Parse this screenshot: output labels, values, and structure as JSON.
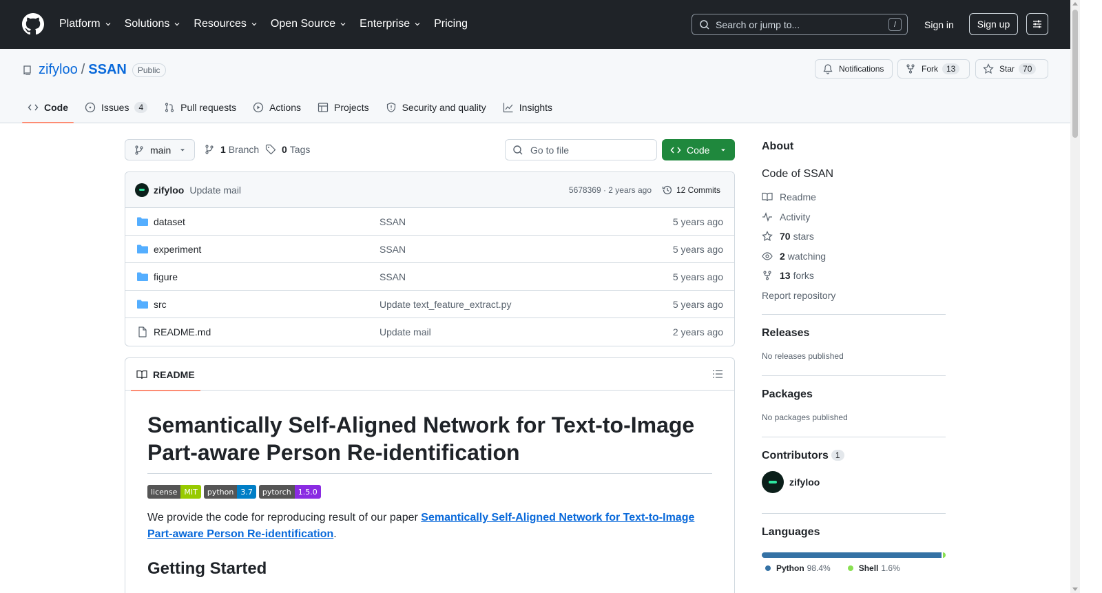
{
  "header": {
    "nav": [
      {
        "label": "Platform"
      },
      {
        "label": "Solutions"
      },
      {
        "label": "Resources"
      },
      {
        "label": "Open Source"
      },
      {
        "label": "Enterprise"
      },
      {
        "label": "Pricing"
      }
    ],
    "search_placeholder": "Search or jump to...",
    "search_shortcut": "/",
    "sign_in": "Sign in",
    "sign_up": "Sign up"
  },
  "repo": {
    "owner": "zifyloo",
    "separator": "/",
    "name": "SSAN",
    "visibility": "Public",
    "notifications_label": "Notifications",
    "fork_label": "Fork",
    "fork_count": "13",
    "star_label": "Star",
    "star_count": "70"
  },
  "tabs": [
    {
      "label": "Code",
      "icon": "code-icon"
    },
    {
      "label": "Issues",
      "icon": "issue-icon",
      "count": "4"
    },
    {
      "label": "Pull requests",
      "icon": "pull-request-icon"
    },
    {
      "label": "Actions",
      "icon": "play-icon"
    },
    {
      "label": "Projects",
      "icon": "table-icon"
    },
    {
      "label": "Security and quality",
      "icon": "shield-icon"
    },
    {
      "label": "Insights",
      "icon": "graph-icon"
    }
  ],
  "branch": {
    "current": "main",
    "branch_count": "1",
    "branch_label": "Branch",
    "tag_count": "0",
    "tag_label": "Tags",
    "goto_placeholder": "Go to file",
    "code_button": "Code"
  },
  "latest_commit": {
    "author": "zifyloo",
    "message": "Update mail",
    "hash_time": "5678369 · 2 years ago",
    "commits_label": "12 Commits"
  },
  "files": [
    {
      "name": "dataset",
      "type": "dir",
      "message": "SSAN",
      "date": "5 years ago"
    },
    {
      "name": "experiment",
      "type": "dir",
      "message": "SSAN",
      "date": "5 years ago"
    },
    {
      "name": "figure",
      "type": "dir",
      "message": "SSAN",
      "date": "5 years ago"
    },
    {
      "name": "src",
      "type": "dir",
      "message": "Update text_feature_extract.py",
      "date": "5 years ago"
    },
    {
      "name": "README.md",
      "type": "file",
      "message": "Update mail",
      "date": "2 years ago"
    }
  ],
  "readme": {
    "tab_label": "README",
    "title": "Semantically Self-Aligned Network for Text-to-Image Part-aware Person Re-identification",
    "badges": [
      {
        "key": "license",
        "value": "MIT",
        "color": "#97ca00"
      },
      {
        "key": "python",
        "value": "3.7",
        "color": "#007ec6"
      },
      {
        "key": "pytorch",
        "value": "1.5.0",
        "color": "#8a2be2"
      }
    ],
    "intro_text": "We provide the code for reproducing result of our paper ",
    "intro_link": "Semantically Self-Aligned Network for Text-to-Image Part-aware Person Re-identification",
    "intro_end": ".",
    "section_heading": "Getting Started"
  },
  "sidebar": {
    "about_heading": "About",
    "description": "Code of SSAN",
    "readme_link": "Readme",
    "activity_link": "Activity",
    "stars_count": "70",
    "stars_label": "stars",
    "watching_count": "2",
    "watching_label": "watching",
    "forks_count": "13",
    "forks_label": "forks",
    "report": "Report repository",
    "releases_heading": "Releases",
    "releases_text": "No releases published",
    "packages_heading": "Packages",
    "packages_text": "No packages published",
    "contributors_heading": "Contributors",
    "contributors_count": "1",
    "contributor_name": "zifyloo",
    "languages_heading": "Languages",
    "languages": [
      {
        "name": "Python",
        "percent": "98.4%",
        "value": 98.4,
        "color": "#3572A5"
      },
      {
        "name": "Shell",
        "percent": "1.6%",
        "value": 1.6,
        "color": "#89e051"
      }
    ]
  }
}
